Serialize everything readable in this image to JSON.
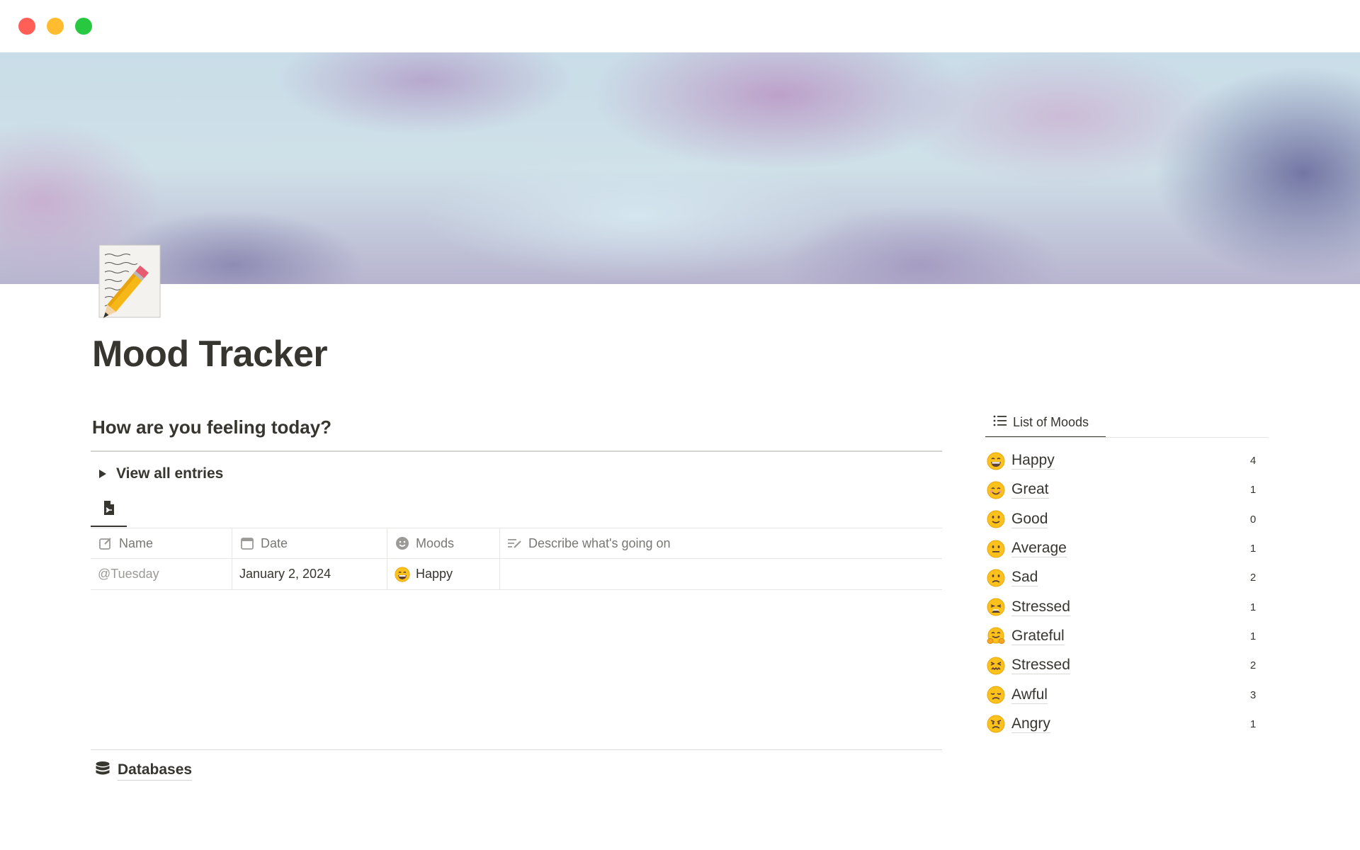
{
  "window": {
    "controls": [
      "close",
      "minimize",
      "maximize"
    ]
  },
  "page": {
    "icon": "memo-pencil-icon",
    "title": "Mood Tracker"
  },
  "main": {
    "heading": "How are you feeling today?",
    "toggle_label": "View all entries",
    "view_tab_icon": "document-export-icon",
    "table": {
      "columns": [
        {
          "label": "Name",
          "icon": "pencil-square-icon"
        },
        {
          "label": "Date",
          "icon": "calendar-icon"
        },
        {
          "label": "Moods",
          "icon": "smiley-icon"
        },
        {
          "label": "Describe what's going on",
          "icon": "text-lines-edit-icon"
        }
      ],
      "rows": [
        {
          "name": "@Tuesday",
          "date": "January 2, 2024",
          "mood": "Happy",
          "mood_emoji": "grinning-face-icon",
          "description": ""
        }
      ]
    },
    "databases_label": "Databases"
  },
  "sidebar": {
    "tab_label": "List of Moods",
    "moods": [
      {
        "label": "Happy",
        "count": "4",
        "emoji": "grinning-face-icon"
      },
      {
        "label": "Great",
        "count": "1",
        "emoji": "smiling-face-icon"
      },
      {
        "label": "Good",
        "count": "0",
        "emoji": "slight-smile-icon"
      },
      {
        "label": "Average",
        "count": "1",
        "emoji": "neutral-face-icon"
      },
      {
        "label": "Sad",
        "count": "2",
        "emoji": "slightly-frowning-icon"
      },
      {
        "label": "Stressed",
        "count": "1",
        "emoji": "weary-face-icon"
      },
      {
        "label": "Grateful",
        "count": "1",
        "emoji": "hugging-face-icon"
      },
      {
        "label": "Stressed",
        "count": "2",
        "emoji": "confounded-face-icon"
      },
      {
        "label": "Awful",
        "count": "3",
        "emoji": "disappointed-face-icon"
      },
      {
        "label": "Angry",
        "count": "1",
        "emoji": "angry-face-icon"
      }
    ]
  },
  "colors": {
    "text": "#37352f",
    "muted": "#787774",
    "emoji_fill": "#fcc21b",
    "close": "#ff5f57",
    "minimize": "#febc2e",
    "maximize": "#28c840"
  }
}
